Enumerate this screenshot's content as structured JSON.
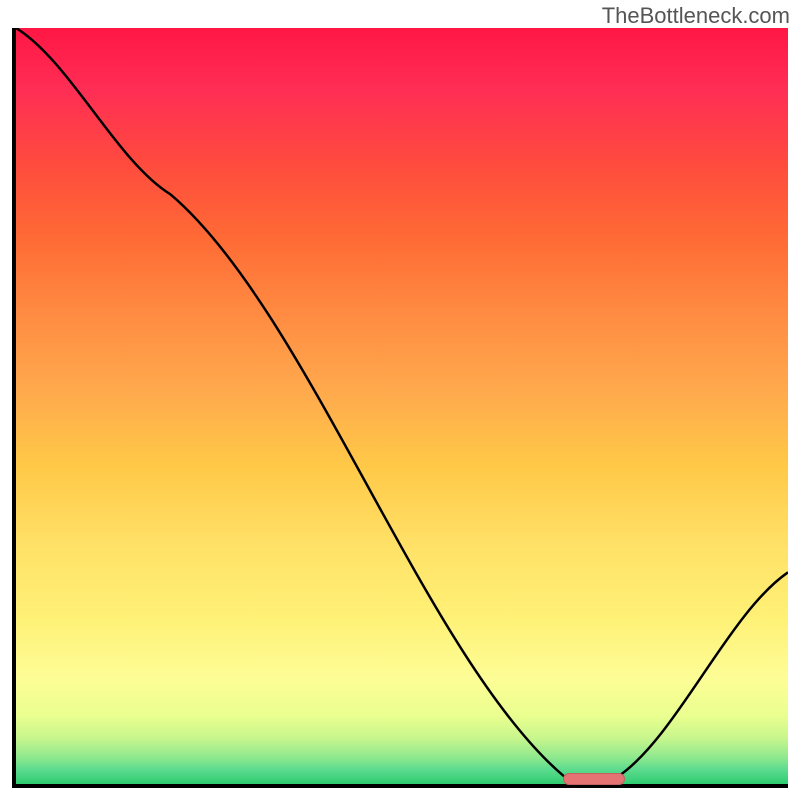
{
  "watermark": "TheBottleneck.com",
  "chart_data": {
    "type": "line",
    "title": "",
    "xlabel": "",
    "ylabel": "",
    "xlim": [
      0,
      100
    ],
    "ylim": [
      0,
      100
    ],
    "x": [
      0,
      20,
      71,
      78,
      100
    ],
    "values": [
      100,
      78,
      1,
      1,
      28
    ],
    "marker": {
      "x_start": 71,
      "x_end": 78,
      "y": 1
    },
    "gradient_stops": [
      {
        "pos": 0,
        "color": "#ff1744"
      },
      {
        "pos": 50,
        "color": "#ffc947"
      },
      {
        "pos": 85,
        "color": "#fdfd96"
      },
      {
        "pos": 100,
        "color": "#2ecc71"
      }
    ]
  }
}
